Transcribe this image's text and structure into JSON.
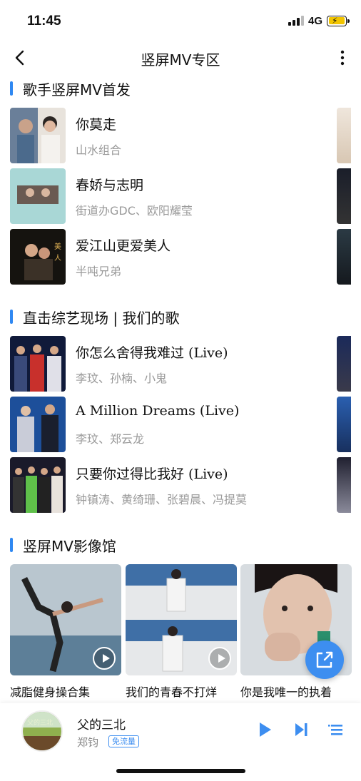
{
  "status_bar": {
    "time": "11:45",
    "network": "4G",
    "battery_color": "#f2c500"
  },
  "nav": {
    "title": "竖屏MV专区",
    "back_icon": "chevron-left-icon",
    "more_icon": "more-vertical-icon"
  },
  "sections": [
    {
      "title": "歌手竖屏MV首发",
      "songs": [
        {
          "name": "你莫走",
          "artist": "山水组合"
        },
        {
          "name": "春娇与志明",
          "artist": "街道办GDC、欧阳耀莹"
        },
        {
          "name": "爱江山更爱美人",
          "artist": "半吨兄弟"
        }
      ]
    },
    {
      "title": "直击综艺现场 | 我们的歌",
      "songs": [
        {
          "name": "你怎么舍得我难过 (Live)",
          "artist": "李玟、孙楠、小鬼"
        },
        {
          "name": "A Million Dreams (Live)",
          "artist": "李玟、郑云龙"
        },
        {
          "name": "只要你过得比我好 (Live)",
          "artist": "钟镇涛、黄绮珊、张碧晨、冯提莫"
        }
      ]
    },
    {
      "title": "竖屏MV影像馆",
      "items": [
        {
          "caption": "减脂健身操合集"
        },
        {
          "caption": "我们的青春不打烊"
        },
        {
          "caption": "你是我唯一的执着"
        }
      ]
    }
  ],
  "share_icon": "share-external-icon",
  "player": {
    "song": "父的三北",
    "artist": "郑钧",
    "badge": "免流量",
    "play_icon": "play-icon",
    "next_icon": "next-track-icon",
    "playlist_icon": "playlist-icon",
    "accent": "#3d8ef0"
  }
}
